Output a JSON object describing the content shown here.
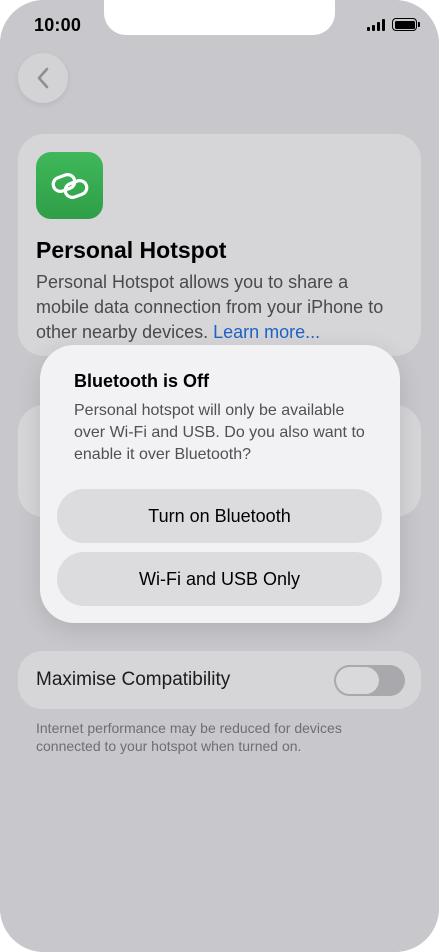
{
  "status_bar": {
    "time": "10:00"
  },
  "info_card": {
    "title": "Personal Hotspot",
    "description": "Personal Hotspot allows you to share a mobile data connection from your iPhone to other nearby devices.",
    "learn_more": "Learn more..."
  },
  "compatibility": {
    "label": "Maximise Compatibility",
    "toggle_on": false,
    "footer": "Internet performance may be reduced for devices connected to your hotspot when turned on."
  },
  "alert": {
    "title": "Bluetooth is Off",
    "message": "Personal hotspot will only be available over Wi-Fi and USB. Do you also want to enable it over Bluetooth?",
    "primary_button": "Turn on Bluetooth",
    "secondary_button": "Wi-Fi and USB Only"
  },
  "colors": {
    "accent": "#1f62c7",
    "icon_green": "#34a853",
    "dim_background": "#c7c7cc"
  },
  "icons": [
    "back-chevron-icon",
    "link-icon",
    "signal-icon",
    "battery-icon"
  ]
}
